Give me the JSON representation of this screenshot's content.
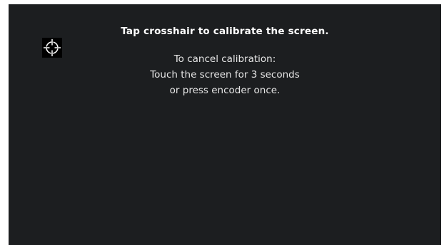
{
  "colors": {
    "background": "#1c1e20",
    "text": "#ffffff",
    "crosshair": "#ffffff",
    "crosshair_bg": "#000000"
  },
  "calibration": {
    "title": "Tap crosshair to calibrate the screen.",
    "cancel_heading": "To cancel calibration:",
    "cancel_line1": "Touch the screen for 3 seconds",
    "cancel_line2": "or press encoder once.",
    "target_icon": "crosshair-icon"
  }
}
